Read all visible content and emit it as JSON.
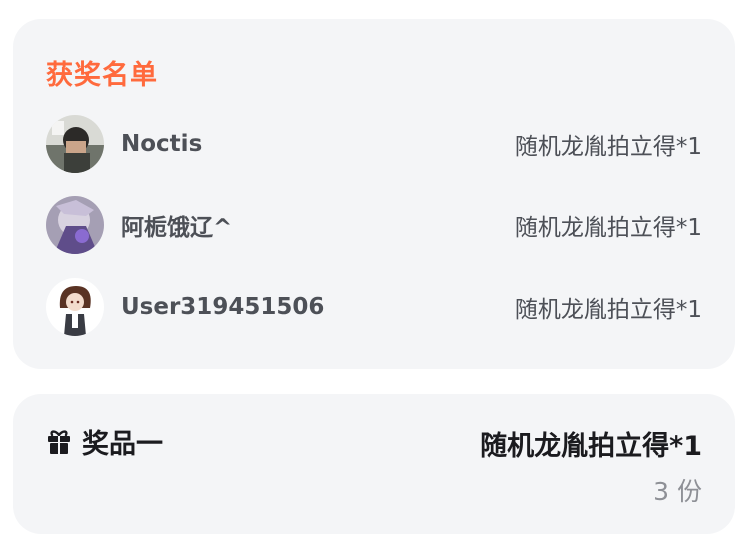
{
  "winners": {
    "title": "获奖名单",
    "items": [
      {
        "name": "Noctis",
        "prize": "随机龙胤拍立得*1"
      },
      {
        "name": "阿栀饿辽^",
        "prize": "随机龙胤拍立得*1"
      },
      {
        "name": "User319451506",
        "prize": "随机龙胤拍立得*1"
      }
    ]
  },
  "prize": {
    "icon": "gift-icon",
    "label": "奖品一",
    "name": "随机龙胤拍立得*1",
    "count": "3 份"
  },
  "colors": {
    "accent": "#ff6a3d",
    "card_bg": "#f4f5f7",
    "text_primary": "#1b1b1f",
    "text_secondary": "#4d5057",
    "text_muted": "#8e9096"
  }
}
